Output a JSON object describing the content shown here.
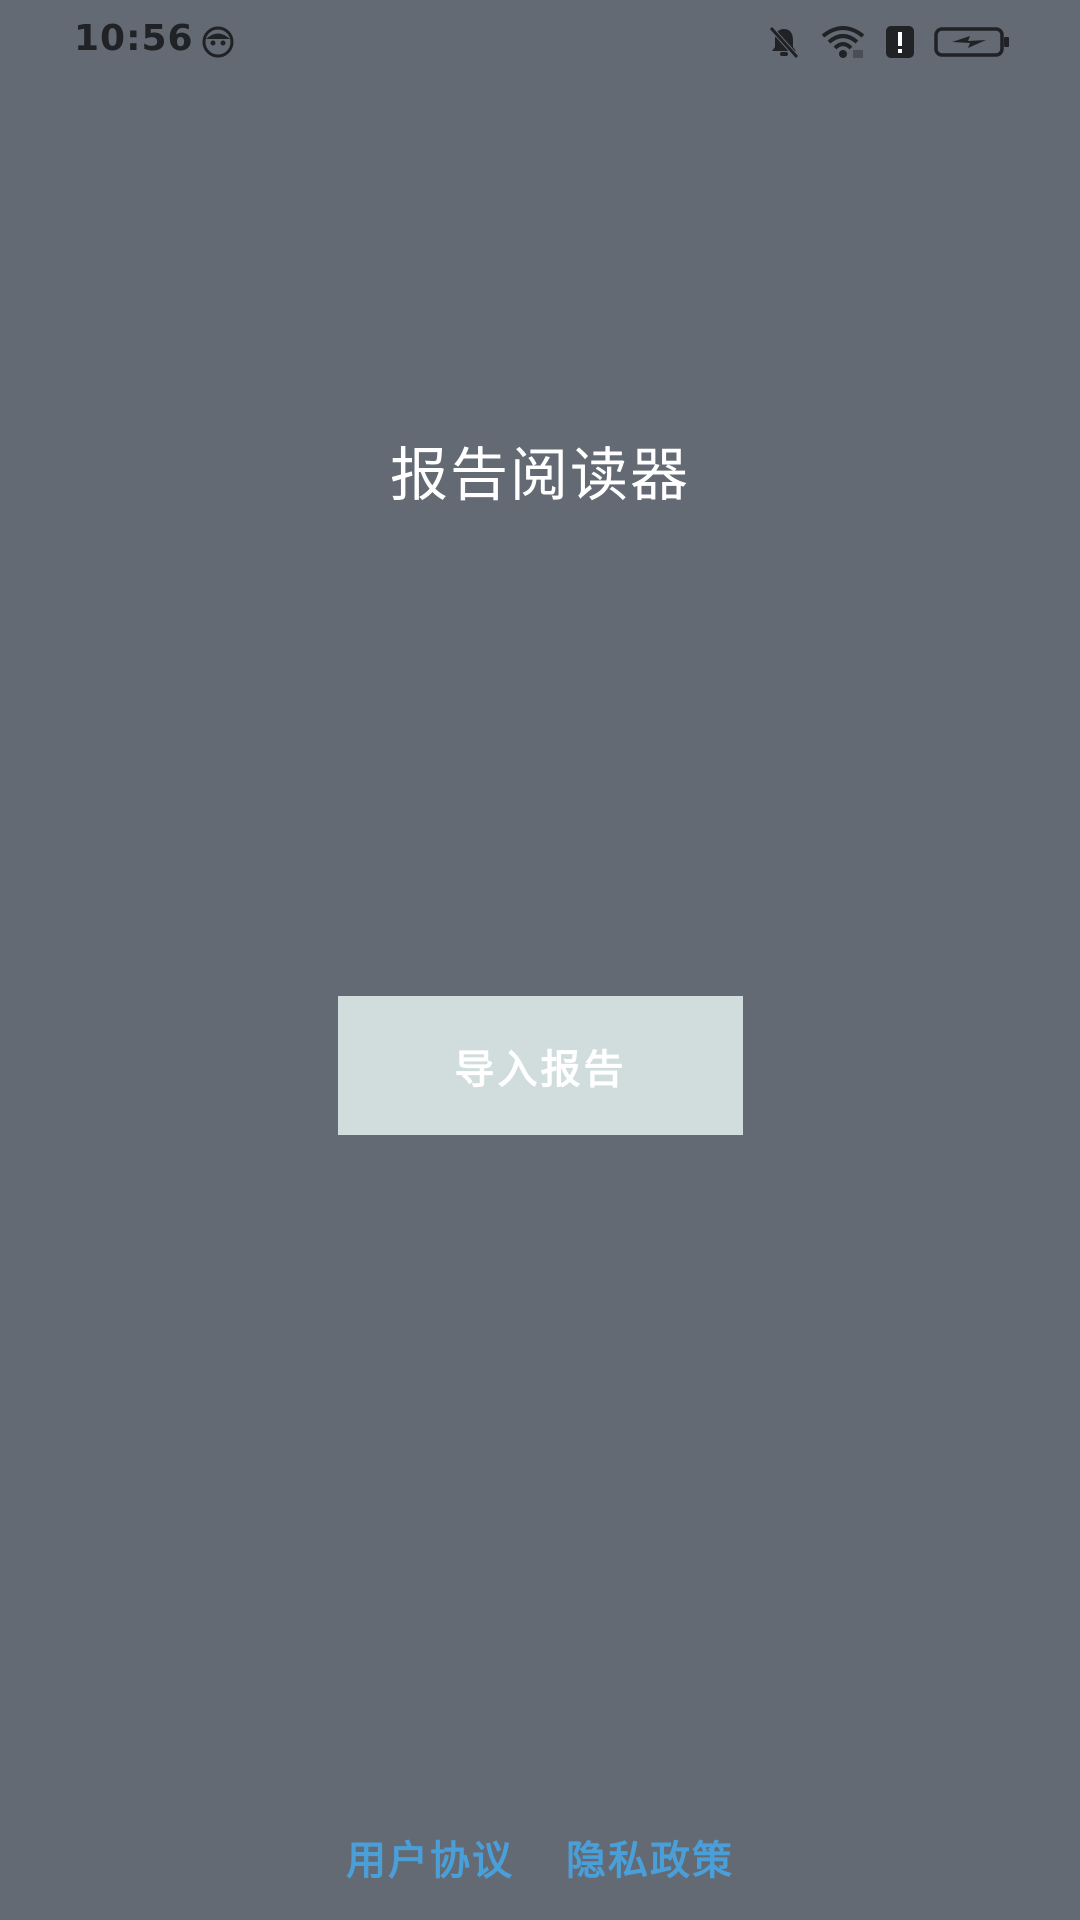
{
  "status_bar": {
    "time": "10:56",
    "icons": [
      "face-icon",
      "bell-muted-icon",
      "wifi-icon",
      "alert-icon",
      "battery-charging-icon"
    ],
    "icon_color": "#202225"
  },
  "app": {
    "title": "报告阅读器"
  },
  "actions": {
    "import_label": "导入报告"
  },
  "footer": {
    "user_agreement": "用户协议",
    "privacy_policy": "隐私政策"
  },
  "colors": {
    "background": "#636a73",
    "button_bg": "#d1dddd",
    "link": "#4a9fd9",
    "title": "#ffffff"
  }
}
